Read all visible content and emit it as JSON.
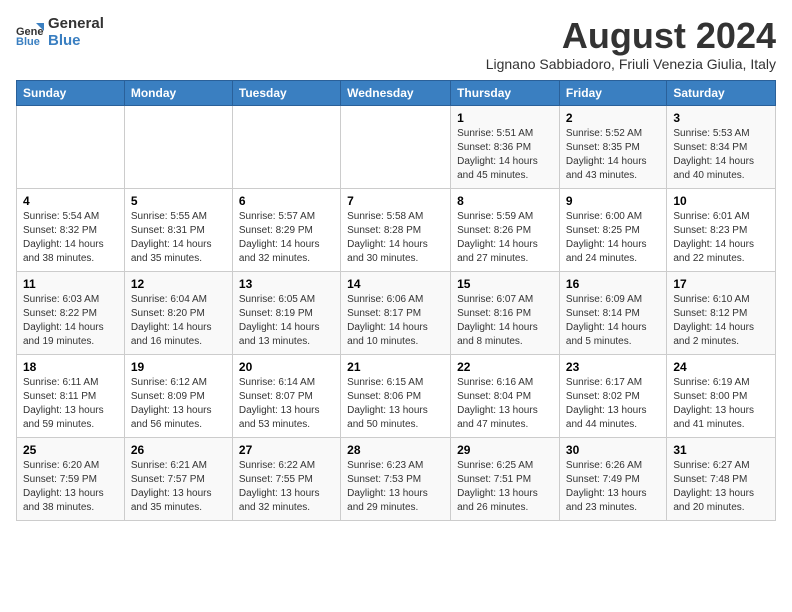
{
  "logo": {
    "general": "General",
    "blue": "Blue"
  },
  "title": "August 2024",
  "subtitle": "Lignano Sabbiadoro, Friuli Venezia Giulia, Italy",
  "days_of_week": [
    "Sunday",
    "Monday",
    "Tuesday",
    "Wednesday",
    "Thursday",
    "Friday",
    "Saturday"
  ],
  "weeks": [
    [
      {
        "day": "",
        "info": ""
      },
      {
        "day": "",
        "info": ""
      },
      {
        "day": "",
        "info": ""
      },
      {
        "day": "",
        "info": ""
      },
      {
        "day": "1",
        "info": "Sunrise: 5:51 AM\nSunset: 8:36 PM\nDaylight: 14 hours and 45 minutes."
      },
      {
        "day": "2",
        "info": "Sunrise: 5:52 AM\nSunset: 8:35 PM\nDaylight: 14 hours and 43 minutes."
      },
      {
        "day": "3",
        "info": "Sunrise: 5:53 AM\nSunset: 8:34 PM\nDaylight: 14 hours and 40 minutes."
      }
    ],
    [
      {
        "day": "4",
        "info": "Sunrise: 5:54 AM\nSunset: 8:32 PM\nDaylight: 14 hours and 38 minutes."
      },
      {
        "day": "5",
        "info": "Sunrise: 5:55 AM\nSunset: 8:31 PM\nDaylight: 14 hours and 35 minutes."
      },
      {
        "day": "6",
        "info": "Sunrise: 5:57 AM\nSunset: 8:29 PM\nDaylight: 14 hours and 32 minutes."
      },
      {
        "day": "7",
        "info": "Sunrise: 5:58 AM\nSunset: 8:28 PM\nDaylight: 14 hours and 30 minutes."
      },
      {
        "day": "8",
        "info": "Sunrise: 5:59 AM\nSunset: 8:26 PM\nDaylight: 14 hours and 27 minutes."
      },
      {
        "day": "9",
        "info": "Sunrise: 6:00 AM\nSunset: 8:25 PM\nDaylight: 14 hours and 24 minutes."
      },
      {
        "day": "10",
        "info": "Sunrise: 6:01 AM\nSunset: 8:23 PM\nDaylight: 14 hours and 22 minutes."
      }
    ],
    [
      {
        "day": "11",
        "info": "Sunrise: 6:03 AM\nSunset: 8:22 PM\nDaylight: 14 hours and 19 minutes."
      },
      {
        "day": "12",
        "info": "Sunrise: 6:04 AM\nSunset: 8:20 PM\nDaylight: 14 hours and 16 minutes."
      },
      {
        "day": "13",
        "info": "Sunrise: 6:05 AM\nSunset: 8:19 PM\nDaylight: 14 hours and 13 minutes."
      },
      {
        "day": "14",
        "info": "Sunrise: 6:06 AM\nSunset: 8:17 PM\nDaylight: 14 hours and 10 minutes."
      },
      {
        "day": "15",
        "info": "Sunrise: 6:07 AM\nSunset: 8:16 PM\nDaylight: 14 hours and 8 minutes."
      },
      {
        "day": "16",
        "info": "Sunrise: 6:09 AM\nSunset: 8:14 PM\nDaylight: 14 hours and 5 minutes."
      },
      {
        "day": "17",
        "info": "Sunrise: 6:10 AM\nSunset: 8:12 PM\nDaylight: 14 hours and 2 minutes."
      }
    ],
    [
      {
        "day": "18",
        "info": "Sunrise: 6:11 AM\nSunset: 8:11 PM\nDaylight: 13 hours and 59 minutes."
      },
      {
        "day": "19",
        "info": "Sunrise: 6:12 AM\nSunset: 8:09 PM\nDaylight: 13 hours and 56 minutes."
      },
      {
        "day": "20",
        "info": "Sunrise: 6:14 AM\nSunset: 8:07 PM\nDaylight: 13 hours and 53 minutes."
      },
      {
        "day": "21",
        "info": "Sunrise: 6:15 AM\nSunset: 8:06 PM\nDaylight: 13 hours and 50 minutes."
      },
      {
        "day": "22",
        "info": "Sunrise: 6:16 AM\nSunset: 8:04 PM\nDaylight: 13 hours and 47 minutes."
      },
      {
        "day": "23",
        "info": "Sunrise: 6:17 AM\nSunset: 8:02 PM\nDaylight: 13 hours and 44 minutes."
      },
      {
        "day": "24",
        "info": "Sunrise: 6:19 AM\nSunset: 8:00 PM\nDaylight: 13 hours and 41 minutes."
      }
    ],
    [
      {
        "day": "25",
        "info": "Sunrise: 6:20 AM\nSunset: 7:59 PM\nDaylight: 13 hours and 38 minutes."
      },
      {
        "day": "26",
        "info": "Sunrise: 6:21 AM\nSunset: 7:57 PM\nDaylight: 13 hours and 35 minutes."
      },
      {
        "day": "27",
        "info": "Sunrise: 6:22 AM\nSunset: 7:55 PM\nDaylight: 13 hours and 32 minutes."
      },
      {
        "day": "28",
        "info": "Sunrise: 6:23 AM\nSunset: 7:53 PM\nDaylight: 13 hours and 29 minutes."
      },
      {
        "day": "29",
        "info": "Sunrise: 6:25 AM\nSunset: 7:51 PM\nDaylight: 13 hours and 26 minutes."
      },
      {
        "day": "30",
        "info": "Sunrise: 6:26 AM\nSunset: 7:49 PM\nDaylight: 13 hours and 23 minutes."
      },
      {
        "day": "31",
        "info": "Sunrise: 6:27 AM\nSunset: 7:48 PM\nDaylight: 13 hours and 20 minutes."
      }
    ]
  ]
}
